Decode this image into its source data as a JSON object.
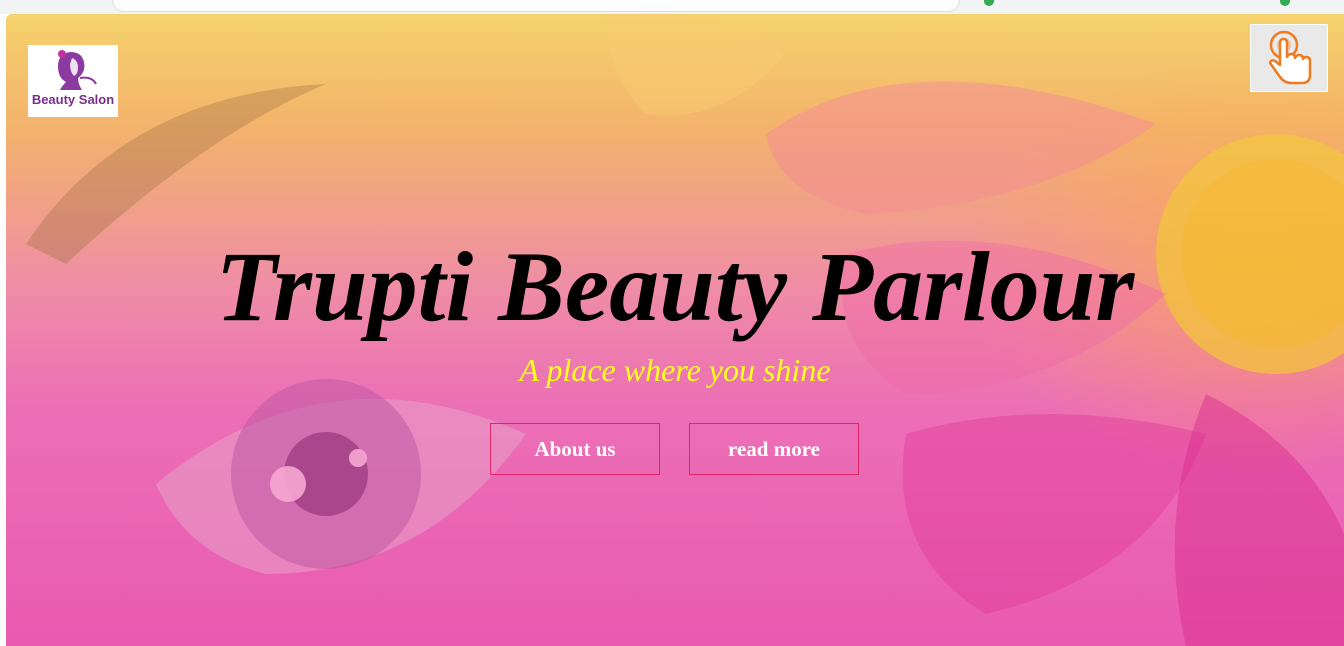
{
  "logo": {
    "text": "Beauty Salon",
    "icon": "woman-silhouette-icon"
  },
  "touch_button": {
    "icon": "hand-pointer-icon"
  },
  "hero": {
    "title": "Trupti Beauty Parlour",
    "subtitle": "A place where you shine",
    "buttons": {
      "about_label": "About us",
      "read_more_label": "read more"
    }
  },
  "colors": {
    "title": "#000000",
    "subtitle": "#ffff1a",
    "button_border": "#e3246a",
    "button_text": "#ffffff",
    "logo_text": "#7a2e8c",
    "touch_icon": "#f07a1f"
  }
}
